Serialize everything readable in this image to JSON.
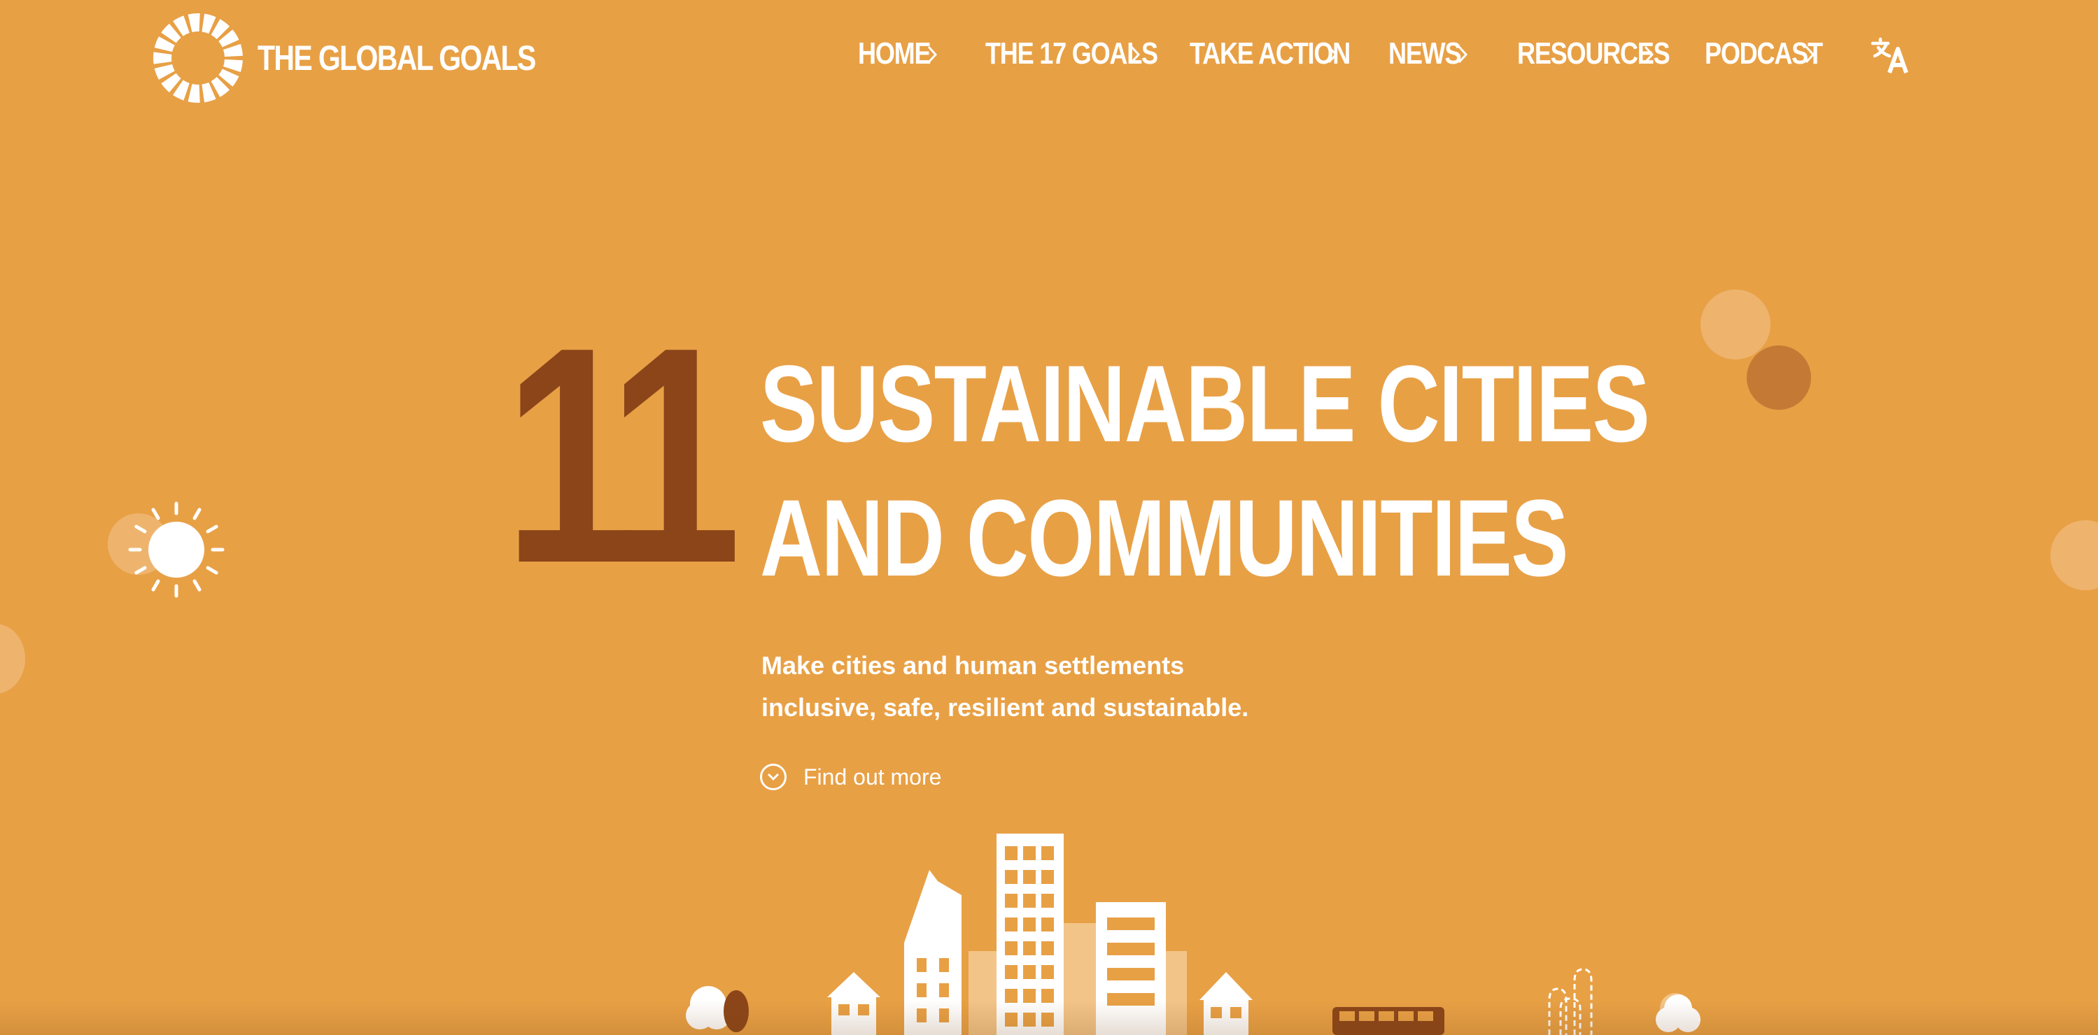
{
  "brand": {
    "name": "THE GLOBAL GOALS",
    "logo_icon": "global-goals-wheel-icon"
  },
  "nav": {
    "items": [
      {
        "label": "HOME"
      },
      {
        "label": "THE 17 GOALS"
      },
      {
        "label": "TAKE ACTION"
      },
      {
        "label": "NEWS"
      },
      {
        "label": "RESOURCES"
      },
      {
        "label": "PODCAST"
      }
    ],
    "chevron_icon": "chevron-right-icon",
    "language_icon": "translate-icon"
  },
  "hero": {
    "goal_number": "11",
    "title_lines": [
      "SUSTAINABLE CITIES",
      "AND COMMUNITIES"
    ],
    "subtitle_lines": [
      "Make cities and human settlements",
      "inclusive, safe, resilient and sustainable."
    ],
    "cta_label": "Find out more",
    "cta_icon": "chevron-down-circle-icon"
  },
  "colors": {
    "background": "#E8A045",
    "accent_dark": "#8B4519",
    "text": "#FFFFFF",
    "bubble_light": "#EEB46E",
    "bubble_dark": "#C47A34"
  },
  "illustrations": {
    "sun_icon": "sun-icon",
    "city_icon": "city-skyline-illustration"
  }
}
